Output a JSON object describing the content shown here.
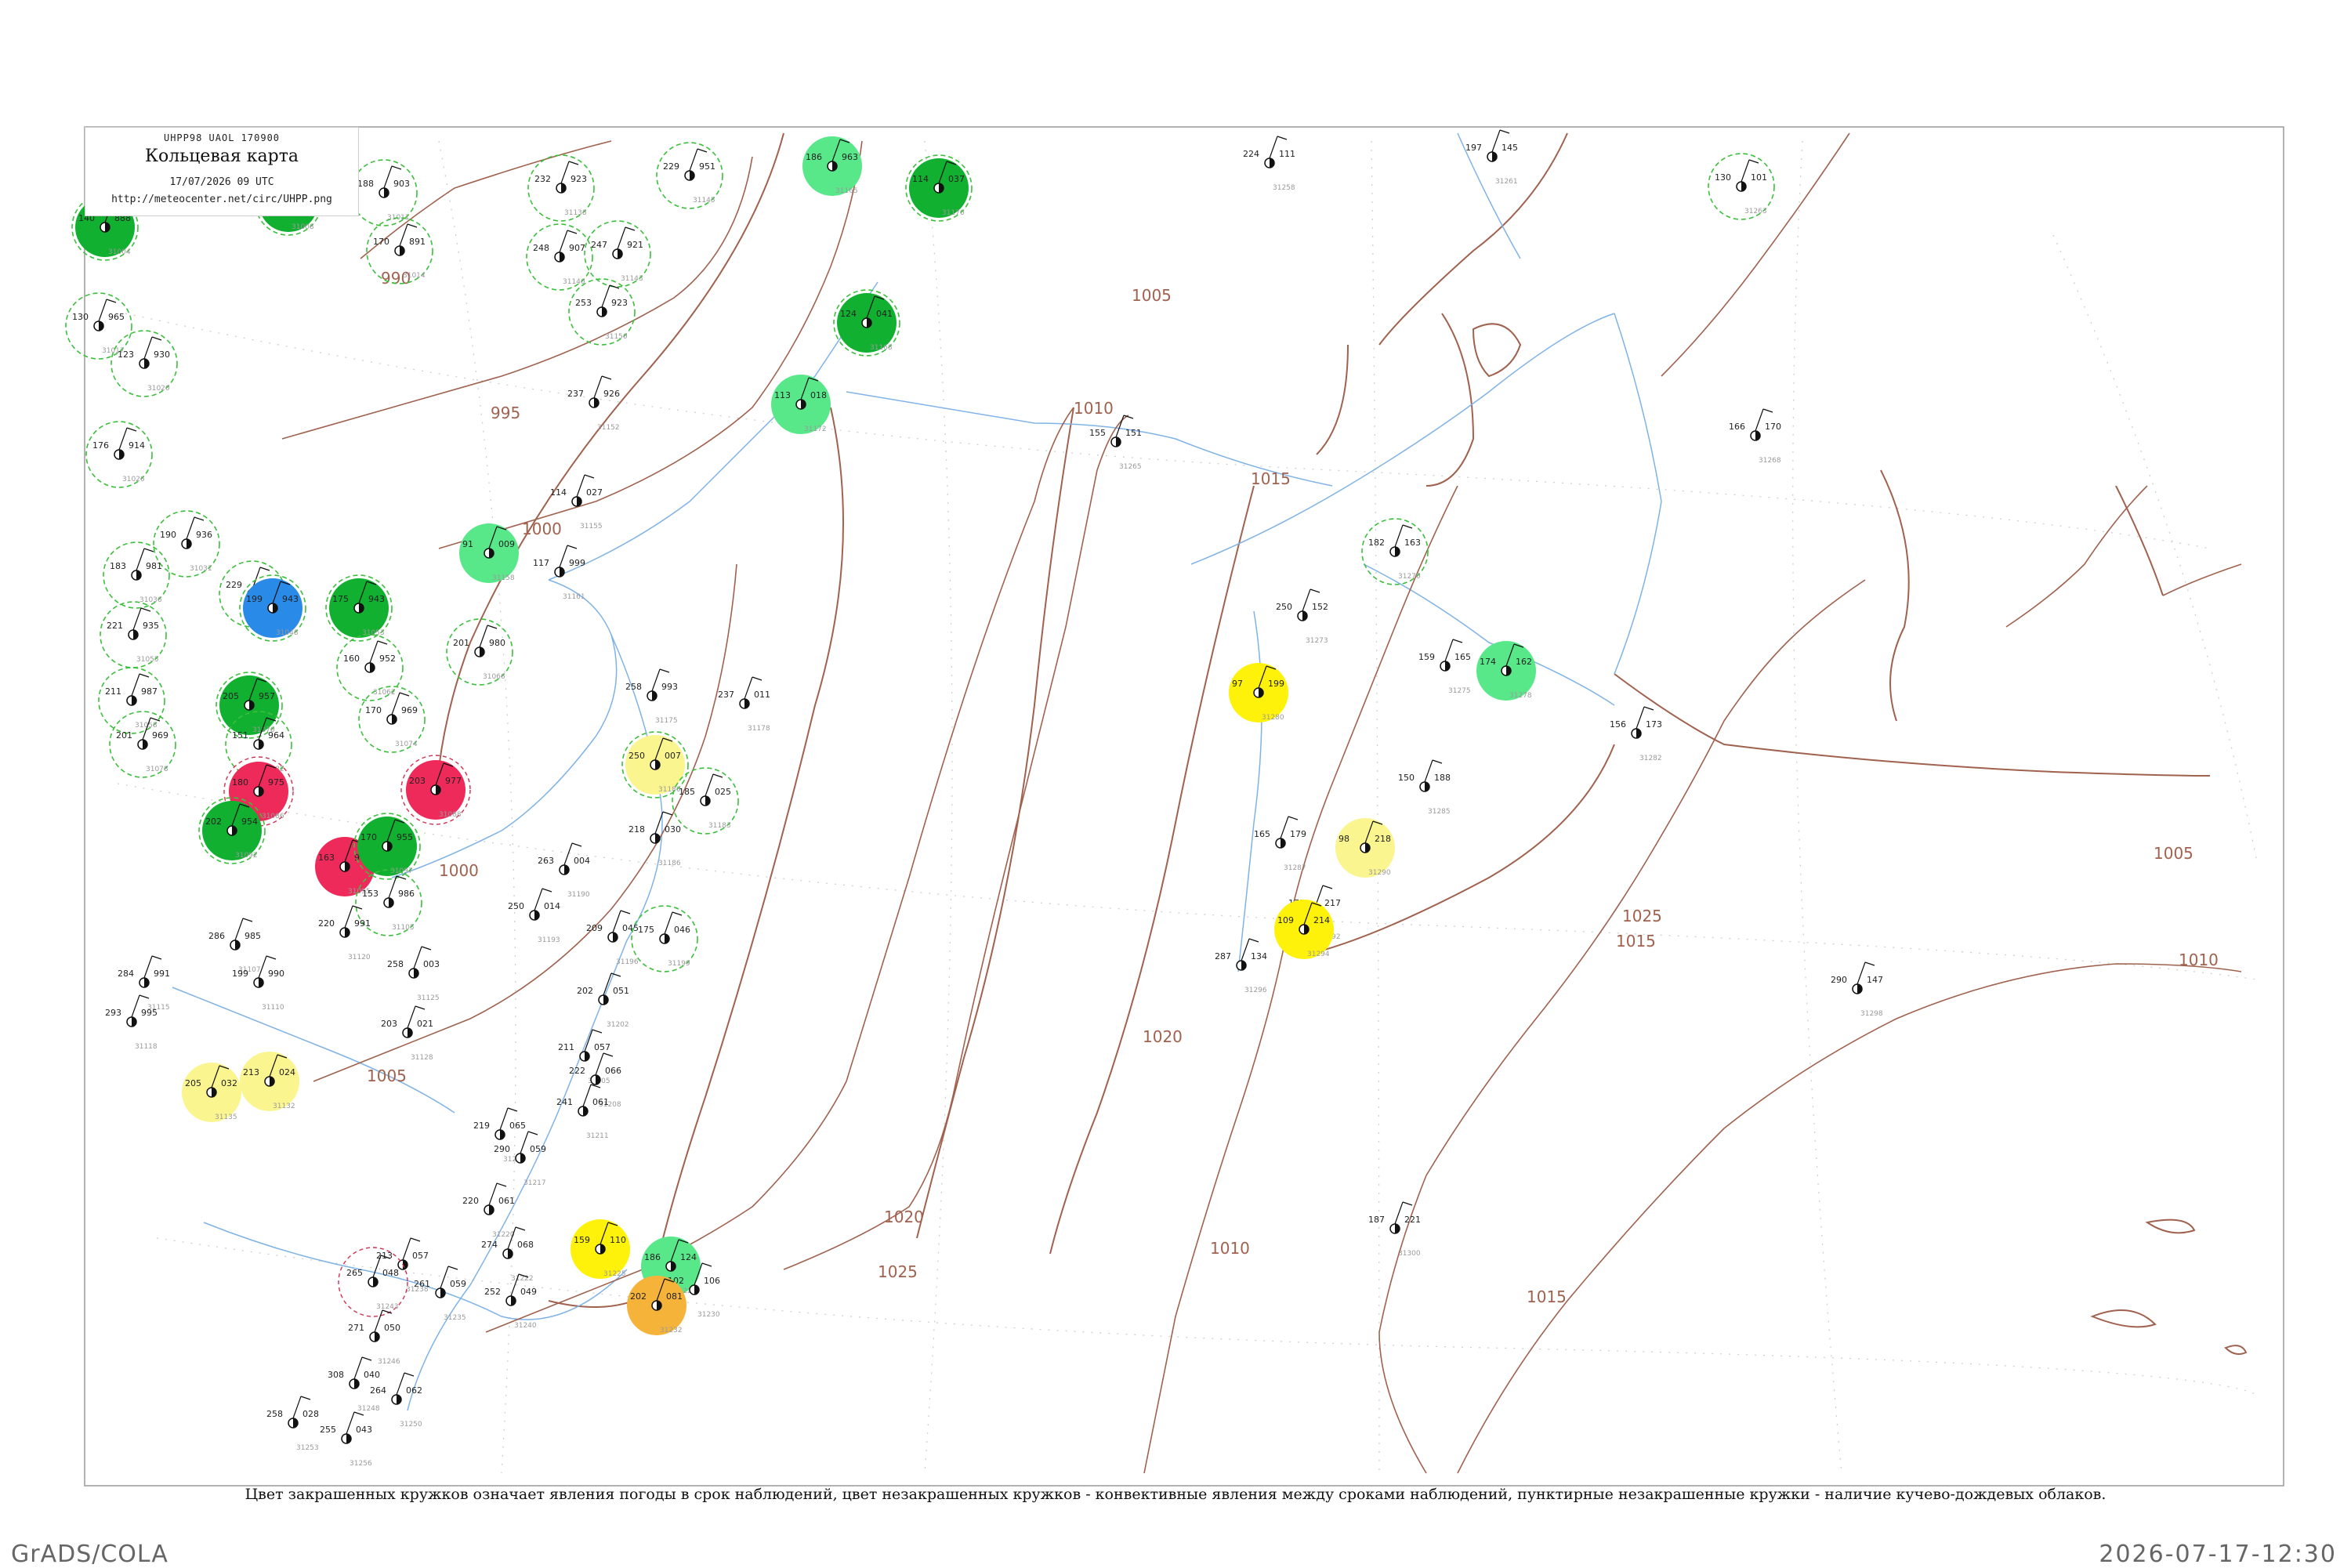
{
  "legend": {
    "code": "UHPP98  UAOL  170900",
    "title": "Кольцевая карта",
    "date": "17/07/2026 09 UTC",
    "url": "http://meteocenter.net/circ/UHPP.png"
  },
  "caption": "Цвет закрашенных кружков означает явления погоды в срок наблюдений, цвет незакрашенных кружков - конвективные явления между сроками наблюдений, пунктирные незакрашенные кружки - наличие кучево-дождевых облаков.",
  "footer": {
    "left": "GrADS/COLA",
    "right": "2026-07-17-12:30"
  },
  "colors": {
    "isobar": "#a0624f",
    "river": "#7fb3e6",
    "frame": "#999999",
    "dark_green": "#11b030",
    "light_green": "#58e88a",
    "blue": "#2a8ae8",
    "red": "#ee2a5a",
    "yellow": "#fff20a",
    "light_yellow": "#fbf590",
    "orange": "#f6b33a",
    "cb_dashed": "#3cbf3c",
    "thunder_ring": "#d23050"
  },
  "isobar_labels": [
    "990",
    "995",
    "1000",
    "1005",
    "1010",
    "1015",
    "1020",
    "1025",
    "1010",
    "1015",
    "1020",
    "1025",
    "1005",
    "1010",
    "1015",
    "1000",
    "1005"
  ],
  "stations": [
    {
      "idx": "31004",
      "t": "888",
      "p": "140",
      "fill": "dark_green",
      "ring": "cb"
    },
    {
      "idx": "31008",
      "t": "883",
      "p": "130",
      "fill": "dark_green",
      "ring": "cb"
    },
    {
      "idx": "31011",
      "t": "903",
      "p": "188",
      "fill": "none",
      "ring": "cb"
    },
    {
      "idx": "31014",
      "t": "891",
      "p": "170",
      "fill": "none",
      "ring": "cb"
    },
    {
      "idx": "31017",
      "t": "965",
      "p": "130",
      "fill": "none",
      "ring": "cb"
    },
    {
      "idx": "31020",
      "t": "930",
      "p": "123",
      "fill": "none",
      "ring": "cb"
    },
    {
      "idx": "31026",
      "t": "914",
      "p": "176",
      "fill": "none",
      "ring": "cb"
    },
    {
      "idx": "31031",
      "t": "936",
      "p": "190",
      "fill": "none",
      "ring": "cb"
    },
    {
      "idx": "31036",
      "t": "981",
      "p": "183",
      "fill": "none",
      "ring": "cb"
    },
    {
      "idx": "31040",
      "t": "926",
      "p": "229",
      "fill": "none",
      "ring": "cb"
    },
    {
      "idx": "31048",
      "t": "943",
      "p": "199",
      "fill": "blue",
      "ring": "cb"
    },
    {
      "idx": "31053",
      "t": "943",
      "p": "175",
      "fill": "dark_green",
      "ring": "cb"
    },
    {
      "idx": "31055",
      "t": "935",
      "p": "221",
      "fill": "none",
      "ring": "cb"
    },
    {
      "idx": "31058",
      "t": "987",
      "p": "211",
      "fill": "none",
      "ring": "cb"
    },
    {
      "idx": "31062",
      "t": "952",
      "p": "160",
      "fill": "none",
      "ring": "cb"
    },
    {
      "idx": "31066",
      "t": "980",
      "p": "201",
      "fill": "none",
      "ring": "cb"
    },
    {
      "idx": "31070",
      "t": "957",
      "p": "205",
      "fill": "dark_green",
      "ring": "cb"
    },
    {
      "idx": "31074",
      "t": "969",
      "p": "170",
      "fill": "none",
      "ring": "cb"
    },
    {
      "idx": "31078",
      "t": "969",
      "p": "201",
      "fill": "none",
      "ring": "cb"
    },
    {
      "idx": "31082",
      "t": "964",
      "p": "151",
      "fill": "none",
      "ring": "cb"
    },
    {
      "idx": "31086",
      "t": "975",
      "p": "180",
      "fill": "red",
      "ring": "thunder"
    },
    {
      "idx": "31088",
      "t": "977",
      "p": "203",
      "fill": "red",
      "ring": "thunder"
    },
    {
      "idx": "31092",
      "t": "954",
      "p": "202",
      "fill": "dark_green",
      "ring": "cb"
    },
    {
      "idx": "31095",
      "t": "943",
      "p": "163",
      "fill": "red",
      "ring": "none"
    },
    {
      "idx": "31097",
      "t": "955",
      "p": "170",
      "fill": "dark_green",
      "ring": "cb"
    },
    {
      "idx": "31105",
      "t": "986",
      "p": "153",
      "fill": "none",
      "ring": "cb"
    },
    {
      "idx": "31107",
      "t": "985",
      "p": "286",
      "fill": "none",
      "ring": "none"
    },
    {
      "idx": "31110",
      "t": "990",
      "p": "199",
      "fill": "none",
      "ring": "none"
    },
    {
      "idx": "31115",
      "t": "991",
      "p": "284",
      "fill": "none",
      "ring": "none"
    },
    {
      "idx": "31118",
      "t": "995",
      "p": "293",
      "fill": "none",
      "ring": "none"
    },
    {
      "idx": "31120",
      "t": "991",
      "p": "220",
      "fill": "none",
      "ring": "none"
    },
    {
      "idx": "31125",
      "t": "003",
      "p": "258",
      "fill": "none",
      "ring": "none"
    },
    {
      "idx": "31128",
      "t": "021",
      "p": "203",
      "fill": "none",
      "ring": "none"
    },
    {
      "idx": "31132",
      "t": "024",
      "p": "213",
      "fill": "light_yellow",
      "ring": "none"
    },
    {
      "idx": "31135",
      "t": "032",
      "p": "205",
      "fill": "light_yellow",
      "ring": "none"
    },
    {
      "idx": "31138",
      "t": "923",
      "p": "232",
      "fill": "none",
      "ring": "cb"
    },
    {
      "idx": "31140",
      "t": "907",
      "p": "248",
      "fill": "none",
      "ring": "cb"
    },
    {
      "idx": "31143",
      "t": "921",
      "p": "247",
      "fill": "none",
      "ring": "cb"
    },
    {
      "idx": "31145",
      "t": "951",
      "p": "229",
      "fill": "none",
      "ring": "cb"
    },
    {
      "idx": "31150",
      "t": "923",
      "p": "253",
      "fill": "none",
      "ring": "cb"
    },
    {
      "idx": "31152",
      "t": "926",
      "p": "237",
      "fill": "none",
      "ring": "none"
    },
    {
      "idx": "31155",
      "t": "027",
      "p": "114",
      "fill": "none",
      "ring": "none"
    },
    {
      "idx": "31158",
      "t": "009",
      "p": "91",
      "fill": "light_green",
      "ring": "none"
    },
    {
      "idx": "31161",
      "t": "999",
      "p": "117",
      "fill": "none",
      "ring": "none"
    },
    {
      "idx": "31165",
      "t": "963",
      "p": "186",
      "fill": "light_green",
      "ring": "none"
    },
    {
      "idx": "31168",
      "t": "041",
      "p": "124",
      "fill": "dark_green",
      "ring": "cb"
    },
    {
      "idx": "31170",
      "t": "037",
      "p": "114",
      "fill": "dark_green",
      "ring": "cb"
    },
    {
      "idx": "31172",
      "t": "018",
      "p": "113",
      "fill": "light_green",
      "ring": "none"
    },
    {
      "idx": "31175",
      "t": "993",
      "p": "258",
      "fill": "none",
      "ring": "none"
    },
    {
      "idx": "31178",
      "t": "011",
      "p": "237",
      "fill": "none",
      "ring": "none"
    },
    {
      "idx": "31180",
      "t": "007",
      "p": "250",
      "fill": "light_yellow",
      "ring": "cb"
    },
    {
      "idx": "31183",
      "t": "025",
      "p": "185",
      "fill": "none",
      "ring": "cb"
    },
    {
      "idx": "31186",
      "t": "030",
      "p": "218",
      "fill": "none",
      "ring": "none"
    },
    {
      "idx": "31190",
      "t": "004",
      "p": "263",
      "fill": "none",
      "ring": "none"
    },
    {
      "idx": "31193",
      "t": "014",
      "p": "250",
      "fill": "none",
      "ring": "none"
    },
    {
      "idx": "31196",
      "t": "045",
      "p": "209",
      "fill": "none",
      "ring": "none"
    },
    {
      "idx": "31199",
      "t": "046",
      "p": "175",
      "fill": "none",
      "ring": "cb"
    },
    {
      "idx": "31202",
      "t": "051",
      "p": "202",
      "fill": "none",
      "ring": "none"
    },
    {
      "idx": "31205",
      "t": "057",
      "p": "211",
      "fill": "none",
      "ring": "none"
    },
    {
      "idx": "31208",
      "t": "066",
      "p": "222",
      "fill": "none",
      "ring": "none"
    },
    {
      "idx": "31211",
      "t": "061",
      "p": "241",
      "fill": "none",
      "ring": "none"
    },
    {
      "idx": "31214",
      "t": "065",
      "p": "219",
      "fill": "none",
      "ring": "none"
    },
    {
      "idx": "31217",
      "t": "059",
      "p": "290",
      "fill": "none",
      "ring": "none"
    },
    {
      "idx": "31220",
      "t": "061",
      "p": "220",
      "fill": "none",
      "ring": "none"
    },
    {
      "idx": "31222",
      "t": "068",
      "p": "274",
      "fill": "none",
      "ring": "none"
    },
    {
      "idx": "31225",
      "t": "110",
      "p": "159",
      "fill": "yellow",
      "ring": "none"
    },
    {
      "idx": "31228",
      "t": "124",
      "p": "186",
      "fill": "light_green",
      "ring": "none"
    },
    {
      "idx": "31230",
      "t": "106",
      "p": "102",
      "fill": "none",
      "ring": "none"
    },
    {
      "idx": "31232",
      "t": "081",
      "p": "202",
      "fill": "orange",
      "ring": "none"
    },
    {
      "idx": "31235",
      "t": "059",
      "p": "261",
      "fill": "none",
      "ring": "none"
    },
    {
      "idx": "31238",
      "t": "057",
      "p": "213",
      "fill": "none",
      "ring": "none"
    },
    {
      "idx": "31240",
      "t": "049",
      "p": "252",
      "fill": "none",
      "ring": "none"
    },
    {
      "idx": "31243",
      "t": "048",
      "p": "265",
      "fill": "none",
      "ring": "thunder"
    },
    {
      "idx": "31246",
      "t": "050",
      "p": "271",
      "fill": "none",
      "ring": "none"
    },
    {
      "idx": "31248",
      "t": "040",
      "p": "308",
      "fill": "none",
      "ring": "none"
    },
    {
      "idx": "31250",
      "t": "062",
      "p": "264",
      "fill": "none",
      "ring": "none"
    },
    {
      "idx": "31253",
      "t": "028",
      "p": "258",
      "fill": "none",
      "ring": "none"
    },
    {
      "idx": "31256",
      "t": "043",
      "p": "255",
      "fill": "none",
      "ring": "none"
    },
    {
      "idx": "31258",
      "t": "111",
      "p": "224",
      "fill": "none",
      "ring": "none"
    },
    {
      "idx": "31261",
      "t": "145",
      "p": "197",
      "fill": "none",
      "ring": "none"
    },
    {
      "idx": "31263",
      "t": "101",
      "p": "130",
      "fill": "none",
      "ring": "cb"
    },
    {
      "idx": "31265",
      "t": "151",
      "p": "155",
      "fill": "none",
      "ring": "none"
    },
    {
      "idx": "31268",
      "t": "170",
      "p": "166",
      "fill": "none",
      "ring": "none"
    },
    {
      "idx": "31270",
      "t": "163",
      "p": "182",
      "fill": "none",
      "ring": "cb"
    },
    {
      "idx": "31273",
      "t": "152",
      "p": "250",
      "fill": "none",
      "ring": "none"
    },
    {
      "idx": "31275",
      "t": "165",
      "p": "159",
      "fill": "none",
      "ring": "none"
    },
    {
      "idx": "31278",
      "t": "162",
      "p": "174",
      "fill": "light_green",
      "ring": "none"
    },
    {
      "idx": "31280",
      "t": "199",
      "p": "97",
      "fill": "yellow",
      "ring": "none"
    },
    {
      "idx": "31282",
      "t": "173",
      "p": "156",
      "fill": "none",
      "ring": "none"
    },
    {
      "idx": "31285",
      "t": "188",
      "p": "150",
      "fill": "none",
      "ring": "none"
    },
    {
      "idx": "31287",
      "t": "179",
      "p": "165",
      "fill": "none",
      "ring": "none"
    },
    {
      "idx": "31290",
      "t": "218",
      "p": "98",
      "fill": "light_yellow",
      "ring": "none"
    },
    {
      "idx": "31292",
      "t": "217",
      "p": "173",
      "fill": "none",
      "ring": "none"
    },
    {
      "idx": "31294",
      "t": "214",
      "p": "109",
      "fill": "yellow",
      "ring": "none"
    },
    {
      "idx": "31296",
      "t": "134",
      "p": "287",
      "fill": "none",
      "ring": "none"
    },
    {
      "idx": "31298",
      "t": "147",
      "p": "290",
      "fill": "none",
      "ring": "none"
    },
    {
      "idx": "31300",
      "t": "221",
      "p": "187",
      "fill": "none",
      "ring": "none"
    }
  ]
}
